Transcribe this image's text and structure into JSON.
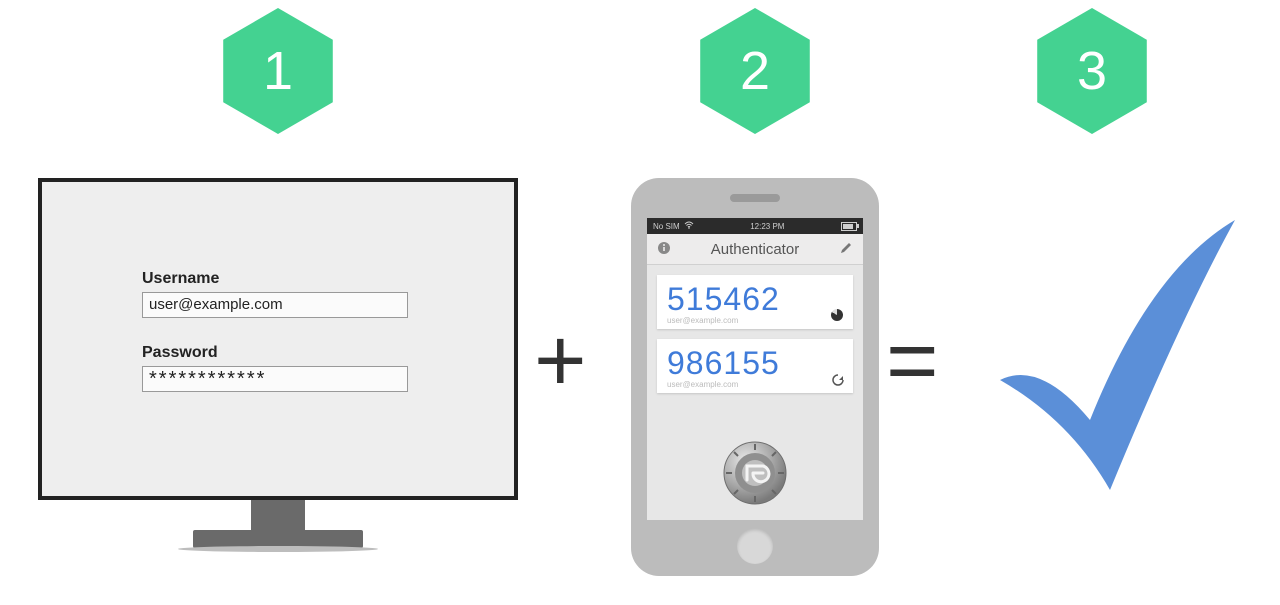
{
  "steps": {
    "one": {
      "number": "1"
    },
    "two": {
      "number": "2"
    },
    "three": {
      "number": "3"
    }
  },
  "operators": {
    "plus": "+",
    "equals": "="
  },
  "login_form": {
    "username_label": "Username",
    "username_value": "user@example.com",
    "password_label": "Password",
    "password_value": "************"
  },
  "phone": {
    "statusbar": {
      "carrier": "No SIM",
      "time": "12:23 PM"
    },
    "app_title": "Authenticator",
    "codes": [
      {
        "value": "515462",
        "account": "user@example.com",
        "indicator": "pie"
      },
      {
        "value": "986155",
        "account": "user@example.com",
        "indicator": "refresh"
      }
    ]
  },
  "colors": {
    "hex_fill": "#44d291",
    "check_fill": "#5b8fd8"
  }
}
